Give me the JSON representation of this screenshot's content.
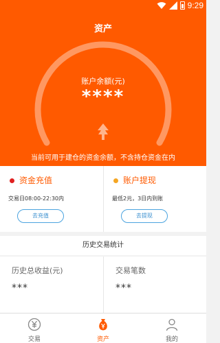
{
  "status_bar": {
    "time": "9:29"
  },
  "header": {
    "title": "资产"
  },
  "balance": {
    "label": "账户余额(元)",
    "value": "****",
    "note": "当前可用于建仓的资金余额，不含持仓资金在内"
  },
  "deposit": {
    "title": "资金充值",
    "info": "交易日08:00-22:30内",
    "button": "去充值",
    "dot_color": "#e02020"
  },
  "withdraw": {
    "title": "账户提现",
    "info": "最低2元，3日内到账",
    "button": "去提现",
    "dot_color": "#f5a623"
  },
  "history": {
    "title": "历史交易统计",
    "total_profit_label": "历史总收益(元)",
    "total_profit_value": "***",
    "trade_count_label": "交易笔数",
    "trade_count_value": "***"
  },
  "nav": {
    "tabs": [
      {
        "label": "交易",
        "icon": "yuan-coin-icon"
      },
      {
        "label": "资产",
        "icon": "money-bag-icon",
        "active": true
      },
      {
        "label": "我的",
        "icon": "person-icon"
      }
    ]
  },
  "colors": {
    "accent": "#ff5a00",
    "link_blue": "#3a8fcf"
  }
}
